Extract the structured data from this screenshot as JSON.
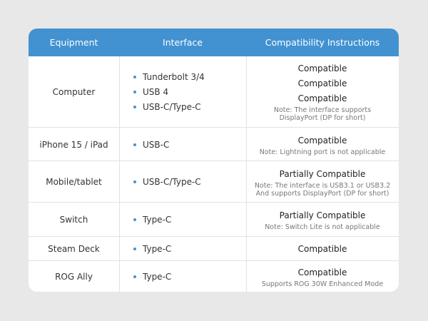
{
  "header": {
    "equipment": "Equipment",
    "interface": "Interface",
    "compatibility": "Compatibility Instructions"
  },
  "rows": [
    {
      "equipment": "Computer",
      "interfaces": [
        "Tunderbolt 3/4",
        "USB 4",
        "USB-C/Type-C"
      ],
      "statuses": [
        "Compatible",
        "Compatible",
        "Compatible"
      ],
      "note_lines": [
        "Note: The interface supports",
        "DisplayPort (DP for short)"
      ]
    },
    {
      "equipment": "iPhone 15 / iPad",
      "interfaces": [
        "USB-C"
      ],
      "statuses": [
        "Compatible"
      ],
      "note_lines": [
        "Note: Lightning port is not applicable"
      ]
    },
    {
      "equipment": "Mobile/tablet",
      "interfaces": [
        "USB-C/Type-C"
      ],
      "statuses": [
        "Partially Compatible"
      ],
      "note_lines": [
        "Note: The interface is USB3.1 or USB3.2",
        "And supports DisplayPort (DP for short)"
      ]
    },
    {
      "equipment": "Switch",
      "interfaces": [
        "Type-C"
      ],
      "statuses": [
        "Partially Compatible"
      ],
      "note_lines": [
        "Note: Switch Lite is not applicable"
      ]
    },
    {
      "equipment": "Steam Deck",
      "interfaces": [
        "Type-C"
      ],
      "statuses": [
        "Compatible"
      ],
      "note_lines": []
    },
    {
      "equipment": "ROG Ally",
      "interfaces": [
        "Type-C"
      ],
      "statuses": [
        "Compatible"
      ],
      "note_lines": [
        "Supports ROG 30W Enhanced Mode"
      ]
    }
  ],
  "colors": {
    "header_bg": "#4292d1",
    "bullet": "#4292d1",
    "card_bg": "#ffffff",
    "page_bg": "#e8e8e8"
  }
}
